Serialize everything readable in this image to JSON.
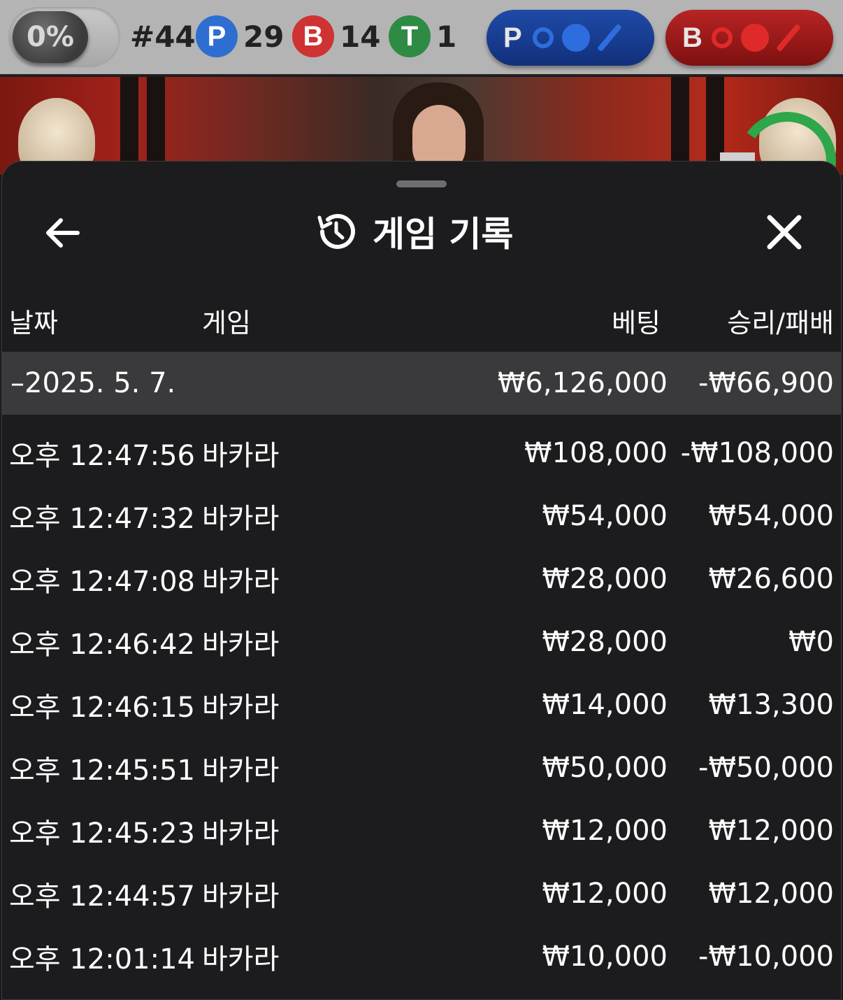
{
  "topbar": {
    "percent": "0%",
    "round": "#44",
    "player": {
      "letter": "P",
      "count": "29"
    },
    "banker": {
      "letter": "B",
      "count": "14"
    },
    "tie": {
      "letter": "T",
      "count": "1"
    },
    "player_ask_label": "P",
    "banker_ask_label": "B"
  },
  "sheet": {
    "title": "게임 기록",
    "columns": {
      "date": "날짜",
      "game": "게임",
      "bet": "베팅",
      "winloss": "승리/패배"
    },
    "date_group": {
      "date": "–2025. 5. 7.",
      "bet_total": "₩6,126,000",
      "winloss_total": "-₩66,900"
    },
    "rows": [
      {
        "time": "오후 12:47:56",
        "game": "바카라",
        "bet": "₩108,000",
        "result": "-₩108,000"
      },
      {
        "time": "오후 12:47:32",
        "game": "바카라",
        "bet": "₩54,000",
        "result": "₩54,000"
      },
      {
        "time": "오후 12:47:08",
        "game": "바카라",
        "bet": "₩28,000",
        "result": "₩26,600"
      },
      {
        "time": "오후 12:46:42",
        "game": "바카라",
        "bet": "₩28,000",
        "result": "₩0"
      },
      {
        "time": "오후 12:46:15",
        "game": "바카라",
        "bet": "₩14,000",
        "result": "₩13,300"
      },
      {
        "time": "오후 12:45:51",
        "game": "바카라",
        "bet": "₩50,000",
        "result": "-₩50,000"
      },
      {
        "time": "오후 12:45:23",
        "game": "바카라",
        "bet": "₩12,000",
        "result": "₩12,000"
      },
      {
        "time": "오후 12:44:57",
        "game": "바카라",
        "bet": "₩12,000",
        "result": "₩12,000"
      },
      {
        "time": "오후 12:01:14",
        "game": "바카라",
        "bet": "₩10,000",
        "result": "-₩10,000"
      }
    ]
  },
  "colors": {
    "player": "#2f6ed1",
    "banker": "#cf3232",
    "tie": "#2e8b43",
    "sheet_bg": "#1c1c1e",
    "date_row_bg": "#3a3a3c"
  },
  "icons": [
    "back-arrow-icon",
    "history-icon",
    "close-icon"
  ]
}
